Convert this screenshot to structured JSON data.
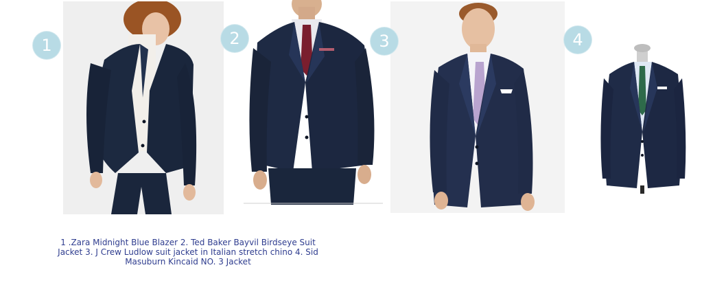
{
  "items": [
    {
      "number": "1",
      "photo": "zara-midnight-blue-blazer-photo"
    },
    {
      "number": "2",
      "photo": "ted-baker-bayvil-birdseye-suit-jacket-photo"
    },
    {
      "number": "3",
      "photo": "j-crew-ludlow-suit-jacket-photo"
    },
    {
      "number": "4",
      "photo": "sid-masuburn-kincaid-no3-jacket-photo"
    }
  ],
  "caption": "1 .Zara Midnight Blue Blazer 2. Ted Baker Bayvil Birdseye Suit Jacket 3. J Crew Ludlow suit jacket in Italian stretch chino 4. Sid Masuburn Kincaid NO. 3 Jacket",
  "colors": {
    "badge": "#b8dbe5",
    "caption_text": "#2f3d8f",
    "navy_suit": "#1e2a44",
    "photo_background": "#f2f2f2"
  }
}
